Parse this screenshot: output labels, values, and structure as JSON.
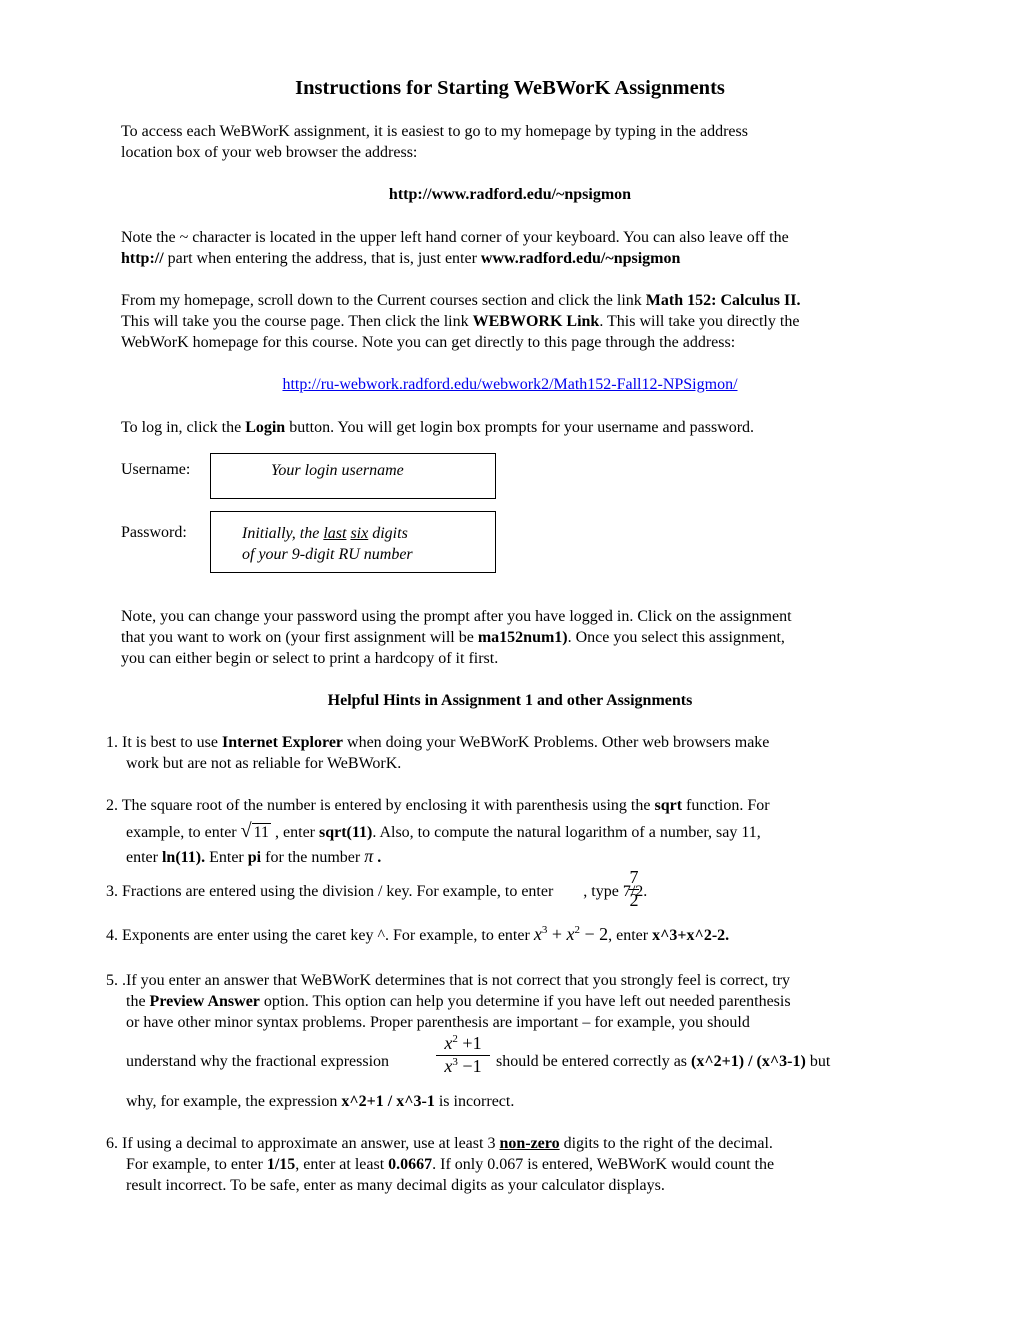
{
  "title": "Instructions for Starting WeBWorK Assignments",
  "intro": {
    "line1": "To access each WeBWorK assignment, it is easiest to go to my homepage by typing in the address",
    "line2": "location box of your web browser the address:"
  },
  "homepage_url": "http://www.radford.edu/~npsigmon",
  "note_tilde": {
    "line1": "Note the ~ character is located in the upper left hand corner of your keyboard. You can also leave off the",
    "line2_bold_start": "http://",
    "line2_mid": " part when entering the address, that is, just enter ",
    "line2_bold_end": "www.radford.edu/~npsigmon"
  },
  "from_homepage": {
    "line1_text": "From my homepage, scroll down to the Current courses section and click the link ",
    "line1_bold": "Math 152: Calculus II.",
    "line2_text_a": "This will take you the course page. Then click the link ",
    "line2_bold": "WEBWORK Link",
    "line2_text_b": ". This will take you directly the",
    "line3": "WebWorK homepage for this course. Note you can get directly to this page through the address:"
  },
  "course_url": "http://ru-webwork.radford.edu/webwork2/Math152-Fall12-NPSigmon/",
  "login": {
    "text_a": "To log in, click the ",
    "bold": "Login",
    "text_b": " button. You will get login box prompts for your username and password."
  },
  "username": {
    "label": "Username:",
    "value": "Your login username"
  },
  "password": {
    "label": "Password:",
    "line1_a": "Initially, the ",
    "line1_u1": "last",
    "line1_sp": " ",
    "line1_u2": "six",
    "line1_b": " digits",
    "line2": "of your 9-digit RU number"
  },
  "note_password": {
    "line1": "Note, you can change your password using the prompt after you have logged in. Click on the assignment",
    "line2_a": "that you want to work on  (your first assignment will be ",
    "line2_bold": "ma152num1)",
    "line2_b": ". Once you select this assignment,",
    "line3": "you can either begin or select to print a hardcopy of it first."
  },
  "hints_heading": "Helpful Hints in Assignment 1 and other Assignments",
  "hints": {
    "h1": {
      "l1_a": "1. It is best to use ",
      "l1_bold": "Internet Explorer",
      "l1_b": " when doing your WeBWorK Problems. Other web browsers make",
      "l2": "work but are not as reliable for WeBWorK."
    },
    "h2": {
      "l1_a": "2. The square root of the number is entered by enclosing it with parenthesis using the ",
      "l1_bold": "sqrt",
      "l1_b": " function. For",
      "l2_a": "example, to enter ",
      "l2_sqrt_arg": "11",
      "l2_b": " , enter ",
      "l2_bold": "sqrt(11)",
      "l2_c": ". Also, to compute the natural logarithm of a number, say 11,",
      "l3_a": "enter ",
      "l3_bold1": "ln(11).",
      "l3_b": "  Enter ",
      "l3_bold2": "pi",
      "l3_c": " for the number ",
      "l3_pi": "π",
      "l3_d": " ."
    },
    "h3": {
      "l1_a": "3. Fractions are entered using the division / key. For example, to enter ",
      "frac_num": "7",
      "frac_den": "2",
      "l1_b": ", type 7/2."
    },
    "h4": {
      "l1_a": "4. Exponents are enter using the caret key ^. For example, to enter ",
      "expr_x": "x",
      "expr_exp1": "3",
      "expr_plus": " + ",
      "expr_exp2": "2",
      "expr_minus": " − 2",
      "l1_b": ", enter  ",
      "l1_bold": "x^3+x^2-2."
    },
    "h5": {
      "l1": "5. .If you enter an answer that WeBWorK determines that is not correct that you strongly feel is correct, try",
      "l2_a": "the ",
      "l2_bold": "Preview Answer",
      "l2_b": " option. This option can help you determine if you have left out needed parenthesis",
      "l3": "or have other minor syntax problems. Proper  parenthesis are important – for example, you should",
      "l4_a": "understand why the fractional  expression",
      "frac_num_x": "x",
      "frac_num_exp": "2",
      "frac_num_rest": " +1",
      "frac_den_x": "x",
      "frac_den_exp": "3",
      "frac_den_rest": " −1",
      "l4_b": "should be entered correctly as ",
      "l4_bold": "(x^2+1) / (x^3-1)",
      "l4_c": " but",
      "l5_a": "why, for example, the expression ",
      "l5_bold": "x^2+1 /  x^3-1",
      "l5_b": "  is incorrect."
    },
    "h6": {
      "l1_a": "6. If using a decimal to approximate an answer, use at least 3 ",
      "l1_bold_u": "non-zero",
      "l1_b": " digits to the right of the decimal.",
      "l2_a": "For example, to enter ",
      "l2_bold1": "1/15",
      "l2_b": ", enter at least ",
      "l2_bold2": "0.0667",
      "l2_c": ". If only 0.067 is entered, WeBWorK would count the",
      "l3": "result incorrect. To be safe, enter as many decimal digits as your calculator displays."
    }
  }
}
